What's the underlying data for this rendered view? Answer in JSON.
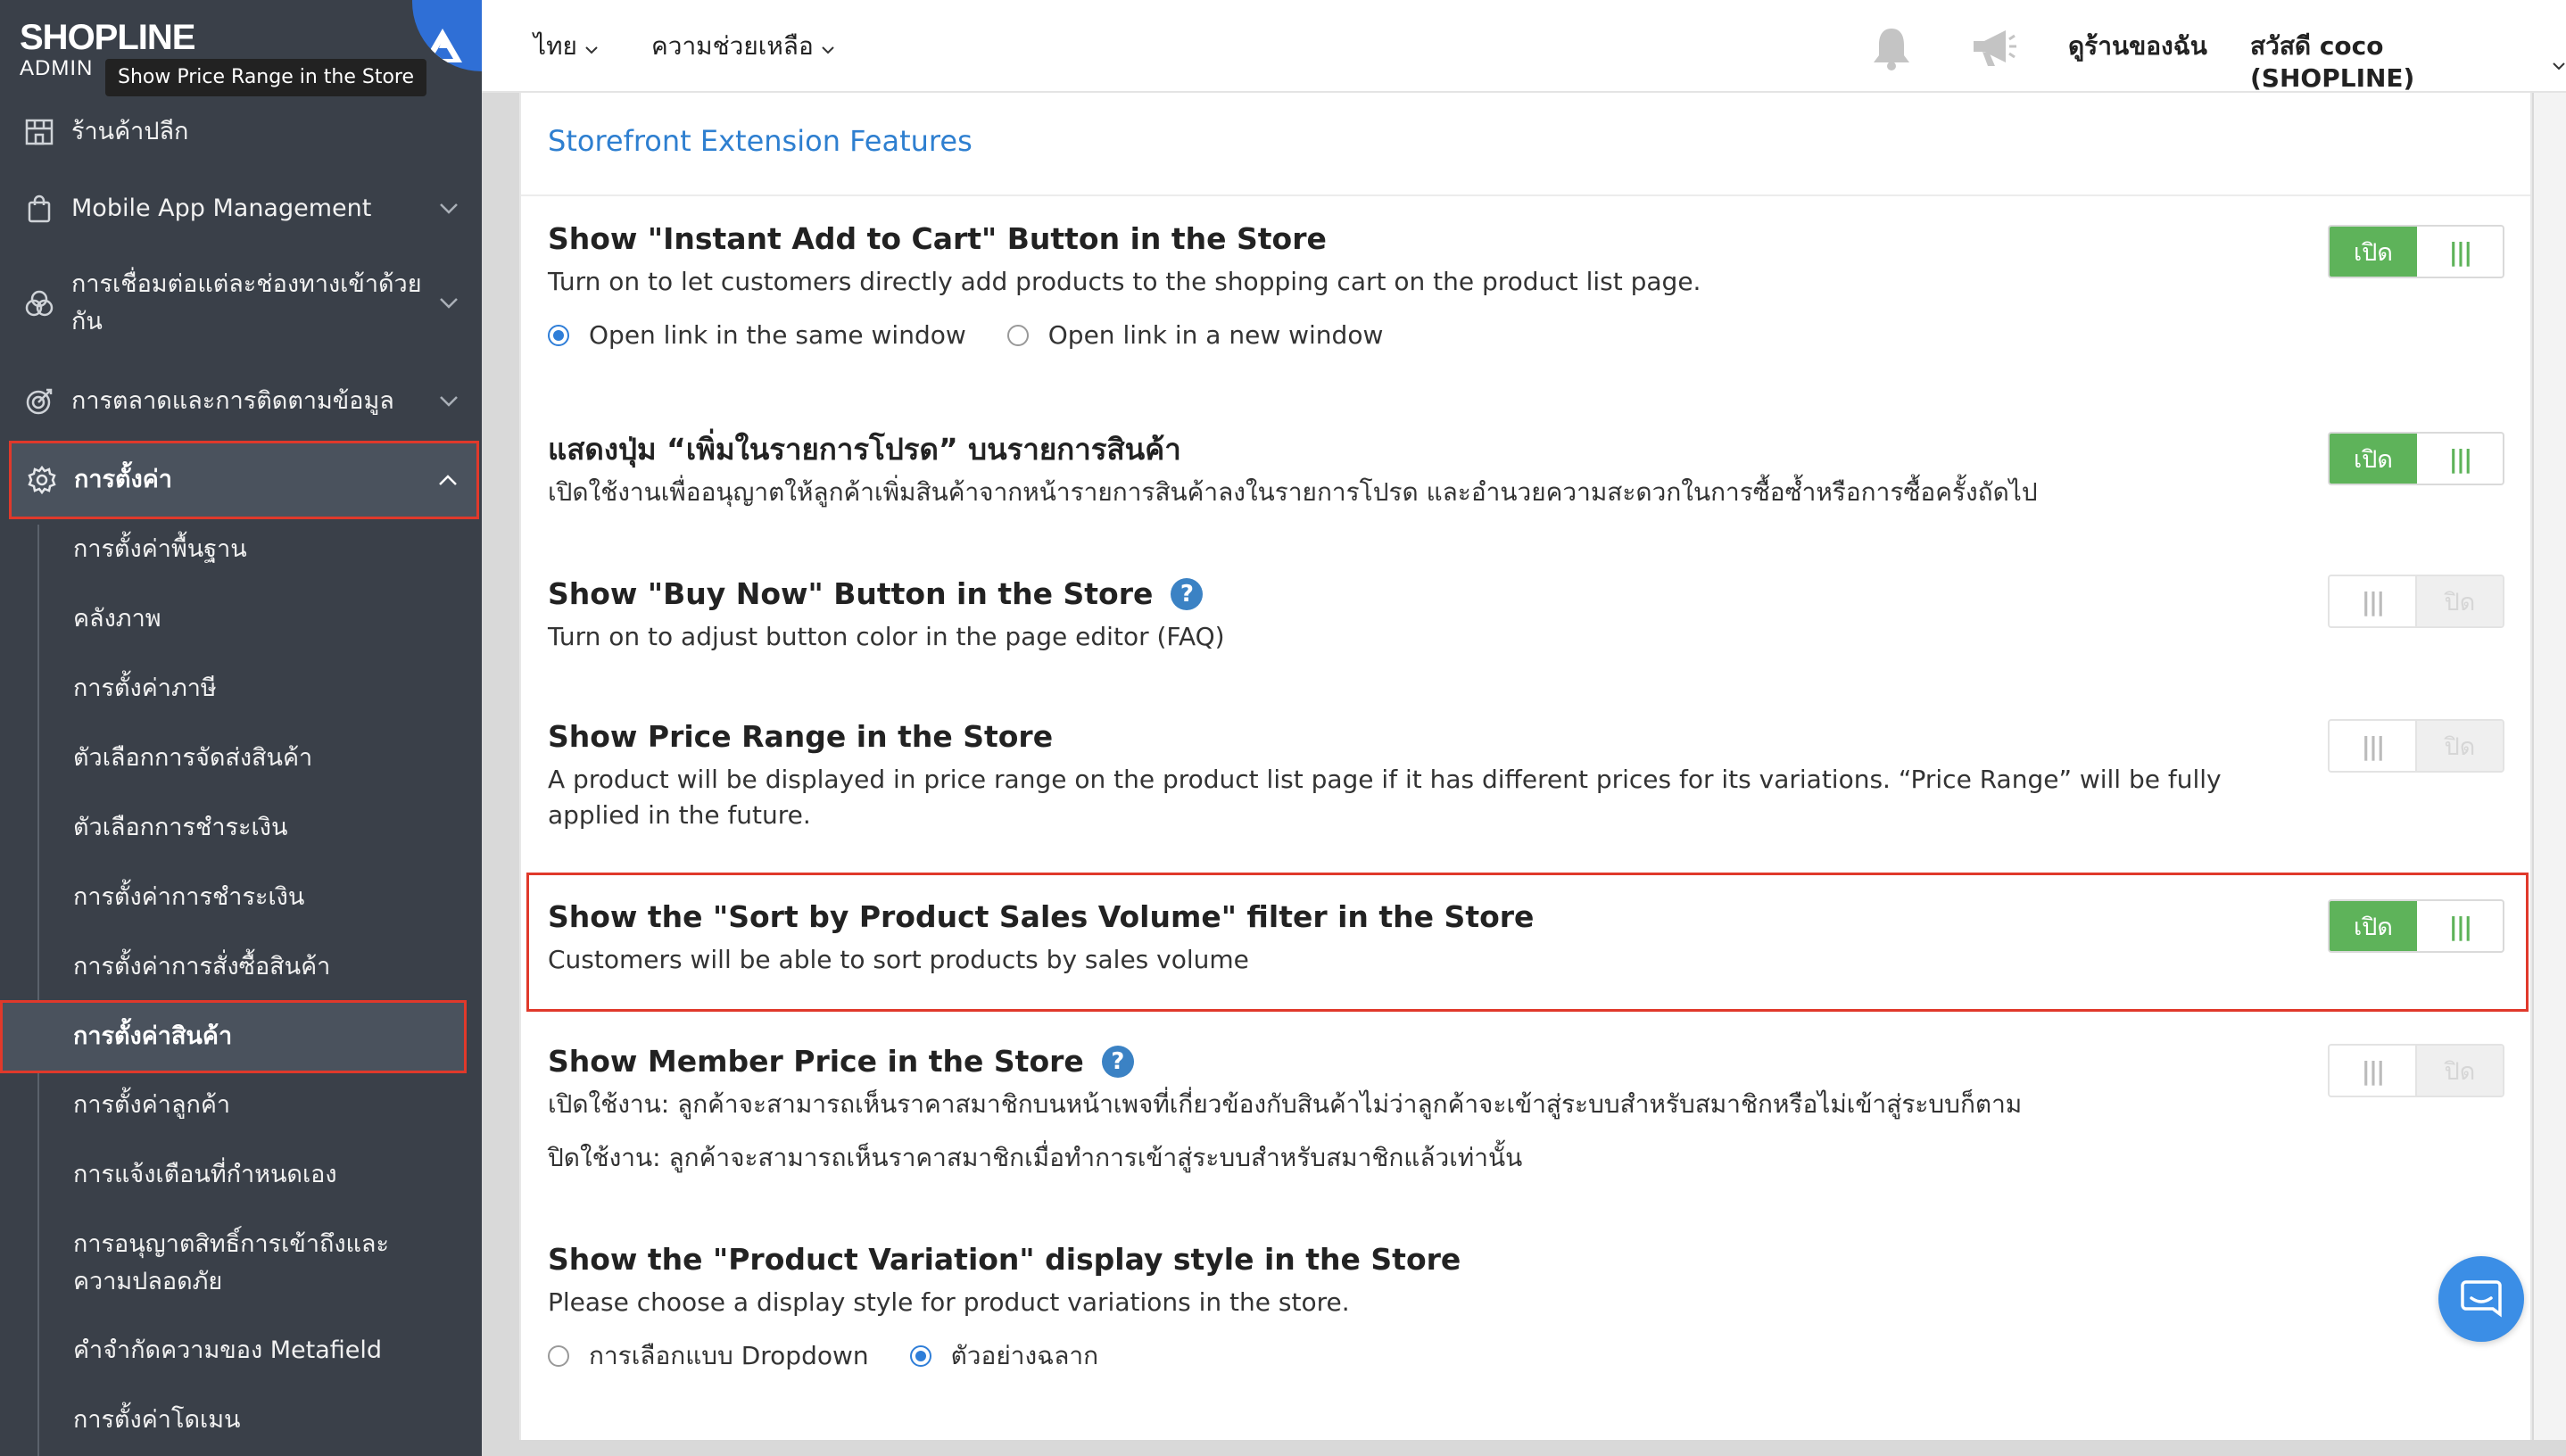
{
  "app": {
    "brand": "SHOPLINE",
    "sub": "ADMIN",
    "tooltip": "Show Price Range in the Store"
  },
  "sidebar": {
    "items": [
      {
        "label": "ร้านค้าปลีก",
        "icon": "store-icon"
      },
      {
        "label": "Mobile App Management",
        "icon": "bag-icon"
      },
      {
        "label": "การเชื่อมต่อแต่ละช่องทางเข้าด้วยกัน",
        "icon": "channels-icon"
      },
      {
        "label": "การตลาดและการติดตามข้อมูล",
        "icon": "target-icon"
      },
      {
        "label": "การตั้งค่า",
        "icon": "gear-icon"
      }
    ],
    "sub_items": [
      "การตั้งค่าพื้นฐาน",
      "คลังภาพ",
      "การตั้งค่าภาษี",
      "ตัวเลือกการจัดส่งสินค้า",
      "ตัวเลือกการชำระเงิน",
      "การตั้งค่าการชำระเงิน",
      "การตั้งค่าการสั่งซื้อสินค้า",
      "การตั้งค่าสินค้า",
      "การตั้งค่าลูกค้า",
      "การแจ้งเตือนที่กำหนดเอง",
      "การอนุญาตสิทธิ์การเข้าถึงและความปลอดภัย",
      "คำจำกัดความของ Metafield",
      "การตั้งค่าโดเมน"
    ]
  },
  "header": {
    "language": "ไทย",
    "help": "ความช่วยเหลือ",
    "view_store": "ดูร้านของฉัน",
    "greeting": "สวัสดี coco (SHOPLINE)"
  },
  "main": {
    "section_title": "Storefront Extension Features",
    "features": [
      {
        "title": "Show \"Instant Add to Cart\" Button in the Store",
        "desc": "Turn on to let customers directly add products to the shopping cart on the product list page.",
        "toggle": "on",
        "radio_options": [
          "Open link in the same window",
          "Open link in a new window"
        ],
        "radio_selected": 0
      },
      {
        "title": "แสดงปุ่ม “เพิ่มในรายการโปรด” บนรายการสินค้า",
        "desc": "เปิดใช้งานเพื่ออนุญาตให้ลูกค้าเพิ่มสินค้าจากหน้ารายการสินค้าลงในรายการโปรด และอำนวยความสะดวกในการซื้อซ้ำหรือการซื้อครั้งถัดไป",
        "toggle": "on"
      },
      {
        "title": "Show \"Buy Now\" Button in the Store",
        "desc": "Turn on to adjust button color in the page editor (FAQ)",
        "toggle": "off",
        "help": "?"
      },
      {
        "title": "Show Price Range in the Store",
        "desc": "A product will be displayed in price range on the product list page if it has different prices for its variations. “Price Range” will be fully applied in the future.",
        "toggle": "off"
      },
      {
        "title": "Show the \"Sort by Product Sales Volume\" filter in the Store",
        "desc": "Customers will be able to sort products by sales volume",
        "toggle": "on"
      },
      {
        "title": "Show Member Price in the Store",
        "desc": "เปิดใช้งาน: ลูกค้าจะสามารถเห็นราคาสมาชิกบนหน้าเพจที่เกี่ยวข้องกับสินค้าไม่ว่าลูกค้าจะเข้าสู่ระบบสำหรับสมาชิกหรือไม่เข้าสู่ระบบก็ตาม",
        "desc2": "ปิดใช้งาน: ลูกค้าจะสามารถเห็นราคาสมาชิกเมื่อทำการเข้าสู่ระบบสำหรับสมาชิกแล้วเท่านั้น",
        "toggle": "off",
        "help": "?"
      },
      {
        "title": "Show the \"Product Variation\" display style in the Store",
        "desc": "Please choose a display style for product variations in the store.",
        "radio_options": [
          "การเลือกแบบ Dropdown",
          "ตัวอย่างฉลาก"
        ],
        "radio_selected": 1
      }
    ],
    "toggle_on_label": "เปิด",
    "toggle_off_label": "ปิด",
    "knob_glyph": "|||"
  },
  "colors": {
    "sidebar_bg": "#3a4049",
    "accent_blue": "#2e7fd0",
    "toggle_green": "#5eb35a",
    "highlight_red": "#e0392b"
  }
}
